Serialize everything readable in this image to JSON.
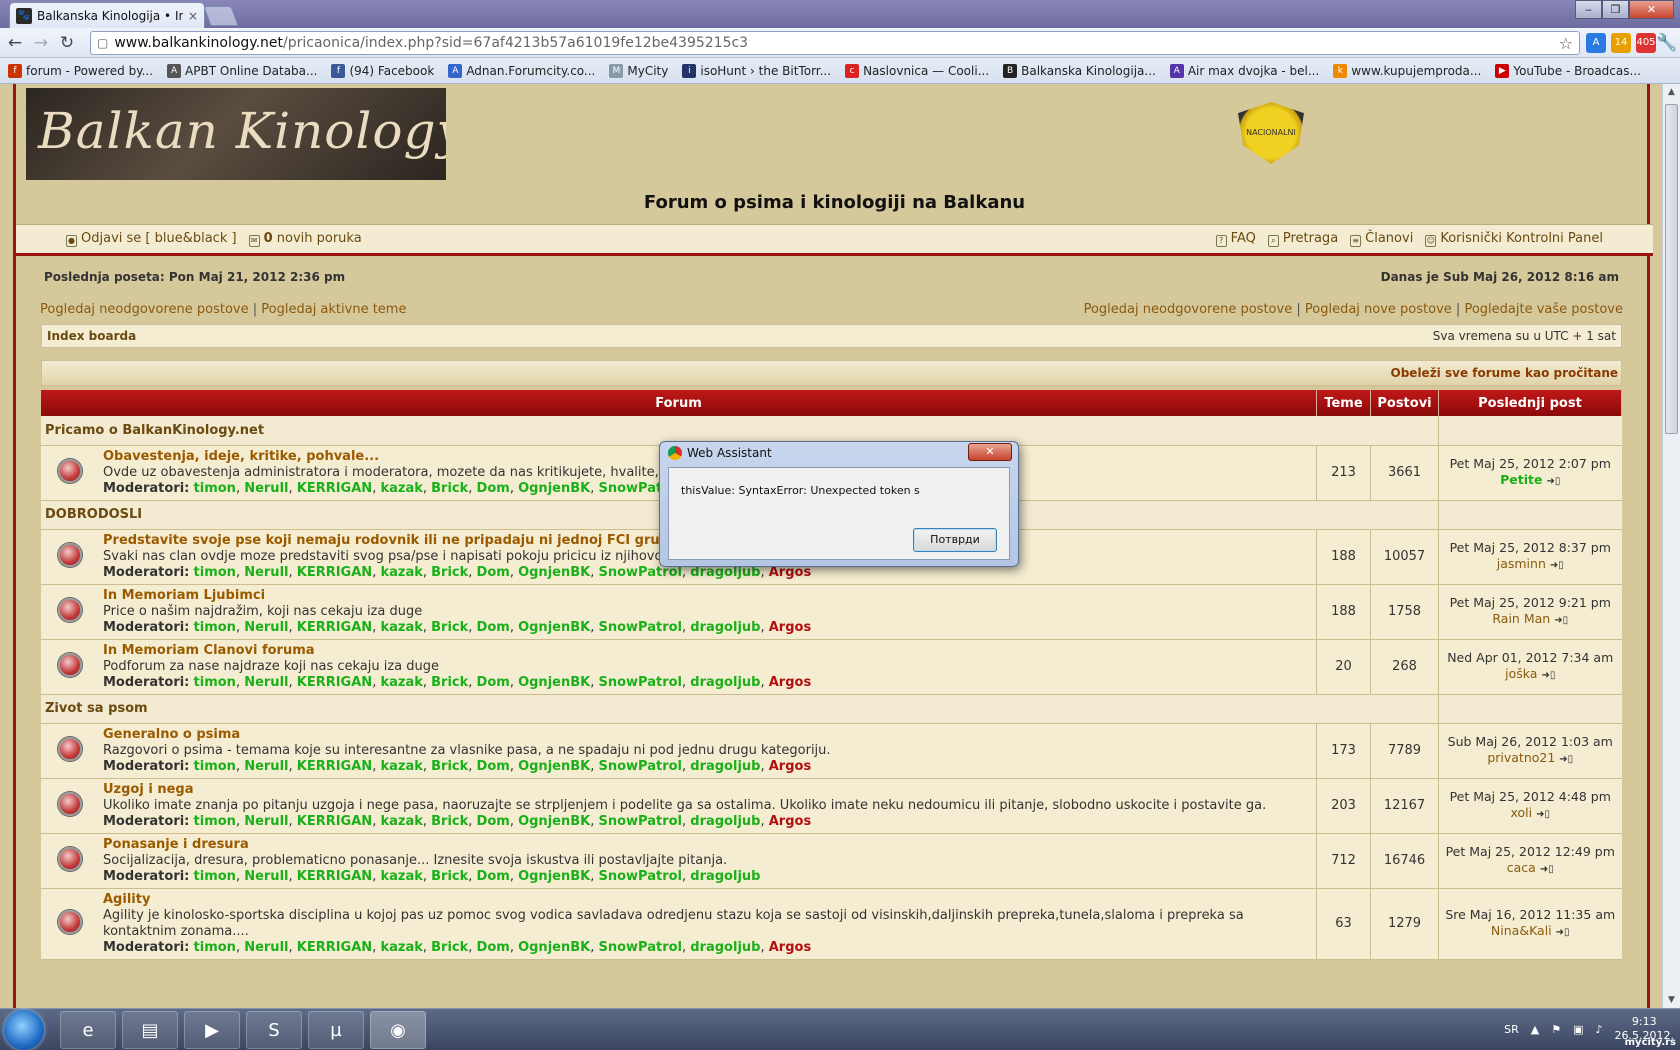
{
  "browser": {
    "tab_title": "Balkanska Kinologija • Index",
    "tab_close": "×",
    "address_domain": "www.balkankinology.net",
    "address_path": "/pricaonica/index.php?sid=67af4213b57a61019fe12be4395215c3",
    "win_minimize": "‒",
    "win_restore": "❐",
    "win_close": "✕",
    "ext_badge_1": "14",
    "ext_badge_2": "405",
    "bookmarks": [
      {
        "label": "forum - Powered by...",
        "color": "#cc3300",
        "glyph": "f"
      },
      {
        "label": "APBT Online Databa...",
        "color": "#555555",
        "glyph": "A"
      },
      {
        "label": "(94) Facebook",
        "color": "#3b5998",
        "glyph": "f"
      },
      {
        "label": "Adnan.Forumcity.co...",
        "color": "#3366cc",
        "glyph": "A"
      },
      {
        "label": "MyCity",
        "color": "#8899aa",
        "glyph": "M"
      },
      {
        "label": "isoHunt › the BitTorr...",
        "color": "#223366",
        "glyph": "i"
      },
      {
        "label": "Naslovnica — Cooli...",
        "color": "#dd2222",
        "glyph": "c"
      },
      {
        "label": "Balkanska Kinologija...",
        "color": "#222222",
        "glyph": "B"
      },
      {
        "label": "Air max dvojka - bel...",
        "color": "#5533aa",
        "glyph": "A"
      },
      {
        "label": "www.kupujemproda...",
        "color": "#ee8800",
        "glyph": "k"
      },
      {
        "label": "YouTube - Broadcas...",
        "color": "#cc0000",
        "glyph": "▶"
      }
    ]
  },
  "header": {
    "logo_text": "Balkan Kinology",
    "badge_text": "NACIONALNI KLUB",
    "site_title": "Forum o psima i kinologiji na Balkanu",
    "logout": "Odjavi se [ blue&black ]",
    "new_messages_count": "0",
    "new_messages_label": "novih poruka",
    "nav": [
      "FAQ",
      "Pretraga",
      "Članovi",
      "Korisnički Kontrolni Panel"
    ]
  },
  "info": {
    "last_visit": "Poslednja poseta: Pon Maj 21, 2012 2:36 pm",
    "today": "Danas je Sub Maj 26, 2012 8:16 am",
    "left_links": [
      "Pogledaj neodgovorene postove",
      "Pogledaj aktivne teme"
    ],
    "right_links": [
      "Pogledaj neodgovorene postove",
      "Pogledaj nove postove",
      "Pogledajte vaše postove"
    ],
    "sep": "|",
    "breadcrumb": "Index boarda",
    "timezone": "Sva vremena su u UTC + 1 sat",
    "mark_read": "Obeleži sve forume kao pročitane"
  },
  "table": {
    "headers": {
      "forum": "Forum",
      "topics": "Teme",
      "posts": "Postovi",
      "last": "Poslednji post"
    },
    "mods_label": "Moderatori:",
    "categories": [
      {
        "name": "Pricamo o BalkanKinology.net",
        "forums": [
          {
            "title": "Obavestenja, ideje, kritike, pohvale...",
            "desc": "Ovde uz obavestenja administratora i moderatora, mozete da nas kritikujete, hvalite, pis",
            "mods": [
              "timon",
              "Nerull",
              "KERRIGAN",
              "kazak",
              "Brick",
              "Dom",
              "OgnjenBK",
              "SnowPatrol",
              "drag"
            ],
            "argos": false,
            "topics": "213",
            "posts": "3661",
            "last_date": "Pet Maj 25, 2012 2:07 pm",
            "last_user": "Petite",
            "user_green": true
          }
        ]
      },
      {
        "name": "DOBRODOSLI",
        "forums": [
          {
            "title": "Predstavite svoje pse koji nemaju rodovnik ili ne pripadaju ni jednoj FCI grupi",
            "desc": "Svaki nas clan ovdje moze predstaviti svog psa/pse i napisati pokoju pricicu iz njihovog svakodnevnog zivota.",
            "mods": [
              "timon",
              "Nerull",
              "KERRIGAN",
              "kazak",
              "Brick",
              "Dom",
              "OgnjenBK",
              "SnowPatrol",
              "dragoljub"
            ],
            "argos": true,
            "topics": "188",
            "posts": "10057",
            "last_date": "Pet Maj 25, 2012 8:37 pm",
            "last_user": "jasminn",
            "user_green": false
          },
          {
            "title": "In Memoriam Ljubimci",
            "desc": "Price o našim najdražim, koji nas cekaju iza duge",
            "mods": [
              "timon",
              "Nerull",
              "KERRIGAN",
              "kazak",
              "Brick",
              "Dom",
              "OgnjenBK",
              "SnowPatrol",
              "dragoljub"
            ],
            "argos": true,
            "topics": "188",
            "posts": "1758",
            "last_date": "Pet Maj 25, 2012 9:21 pm",
            "last_user": "Rain Man",
            "user_green": false
          },
          {
            "title": "In Memoriam Clanovi foruma",
            "desc": "Podforum za nase najdraze koji nas cekaju iza duge",
            "mods": [
              "timon",
              "Nerull",
              "KERRIGAN",
              "kazak",
              "Brick",
              "Dom",
              "OgnjenBK",
              "SnowPatrol",
              "dragoljub"
            ],
            "argos": true,
            "topics": "20",
            "posts": "268",
            "last_date": "Ned Apr 01, 2012 7:34 am",
            "last_user": "joška",
            "user_green": false
          }
        ]
      },
      {
        "name": "Zivot sa psom",
        "forums": [
          {
            "title": "Generalno o psima",
            "desc": "Razgovori o psima - temama koje su interesantne za vlasnike pasa, a ne spadaju ni pod jednu drugu kategoriju.",
            "mods": [
              "timon",
              "Nerull",
              "KERRIGAN",
              "kazak",
              "Brick",
              "Dom",
              "OgnjenBK",
              "SnowPatrol",
              "dragoljub"
            ],
            "argos": true,
            "topics": "173",
            "posts": "7789",
            "last_date": "Sub Maj 26, 2012 1:03 am",
            "last_user": "privatno21",
            "user_green": false
          },
          {
            "title": "Uzgoj i nega",
            "desc": "Ukoliko imate znanja po pitanju uzgoja i nege pasa, naoruzajte se strpljenjem i podelite ga sa ostalima. Ukoliko imate neku nedoumicu ili pitanje, slobodno uskocite i postavite ga.",
            "mods": [
              "timon",
              "Nerull",
              "KERRIGAN",
              "kazak",
              "Brick",
              "Dom",
              "OgnjenBK",
              "SnowPatrol",
              "dragoljub"
            ],
            "argos": true,
            "topics": "203",
            "posts": "12167",
            "last_date": "Pet Maj 25, 2012 4:48 pm",
            "last_user": "xoli",
            "user_green": false
          },
          {
            "title": "Ponasanje i dresura",
            "desc": "Socijalizacija, dresura, problematicno ponasanje... Iznesite svoja iskustva ili postavljajte pitanja.",
            "mods": [
              "timon",
              "Nerull",
              "KERRIGAN",
              "kazak",
              "Brick",
              "Dom",
              "OgnjenBK",
              "SnowPatrol",
              "dragoljub"
            ],
            "argos": false,
            "topics": "712",
            "posts": "16746",
            "last_date": "Pet Maj 25, 2012 12:49 pm",
            "last_user": "caca",
            "user_green": false
          },
          {
            "title": "Agility",
            "desc": "Agility je kinolosko-sportska disciplina u kojoj pas uz pomoc svog vodica savladava odredjenu stazu koja se sastoji od visinskih,daljinskih prepreka,tunela,slaloma i prepreka sa kontaktnim zonama....",
            "mods": [
              "timon",
              "Nerull",
              "KERRIGAN",
              "kazak",
              "Brick",
              "Dom",
              "OgnjenBK",
              "SnowPatrol",
              "dragoljub"
            ],
            "argos": true,
            "topics": "63",
            "posts": "1279",
            "last_date": "Sre Maj 16, 2012 11:35 am",
            "last_user": "Nina&Kali",
            "user_green": false
          }
        ]
      }
    ],
    "argos_name": "Argos"
  },
  "dialog": {
    "title": "Web Assistant",
    "close": "✕",
    "message": "thisValue: SyntaxError: Unexpected token s",
    "ok": "Потврди"
  },
  "taskbar": {
    "lang": "SR",
    "time": "9:13",
    "date": "26.5.2012.",
    "watermark": "mycity.rs"
  }
}
